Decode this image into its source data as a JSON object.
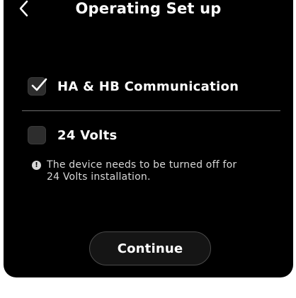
{
  "header": {
    "title": "Operating Set up",
    "back_icon": "chevron-left-icon"
  },
  "options": [
    {
      "label": "HA & HB Communication",
      "checked": true
    },
    {
      "label": "24 Volts",
      "checked": false
    }
  ],
  "info": {
    "icon": "info-icon",
    "glyph": "!",
    "text_line1": "The device needs to be turned off for",
    "text_line2": "24 Volts installation."
  },
  "footer": {
    "continue_label": "Continue"
  },
  "colors": {
    "panel_background": "#000000",
    "text": "#ffffff",
    "checkbox_fill": "#2d2d2d",
    "divider": "#6f6f6f"
  }
}
